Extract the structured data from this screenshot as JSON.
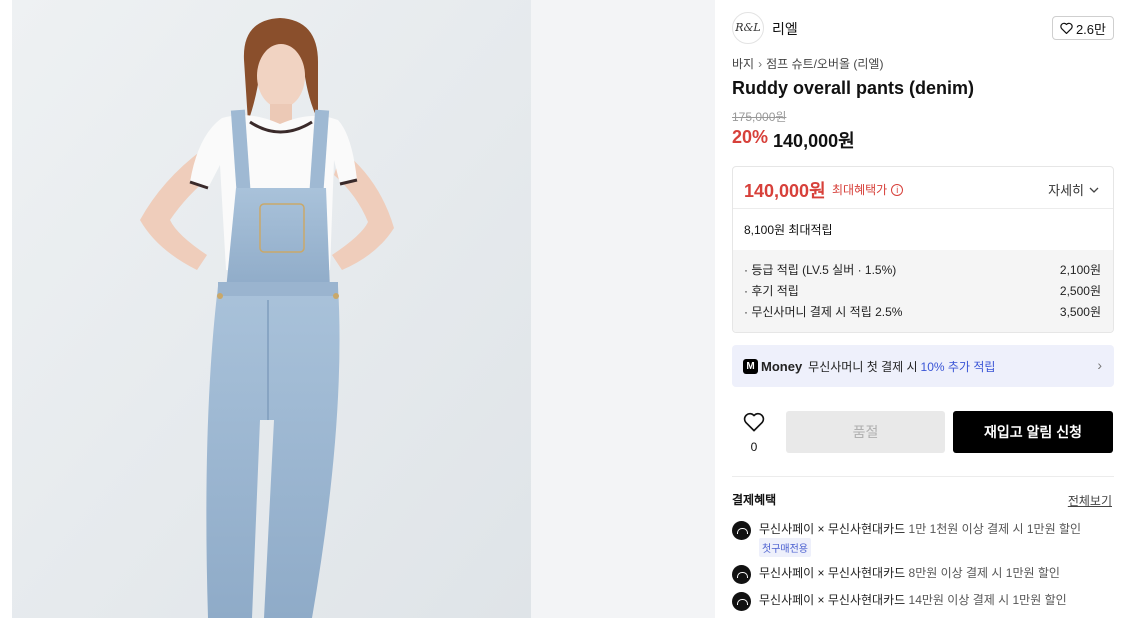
{
  "brand": {
    "logo_text": "R&L",
    "name": "리엘",
    "likes": "2.6만"
  },
  "breadcrumb": [
    "바지",
    "점프 슈트/오버올 (리엘)"
  ],
  "product": {
    "title": "Ruddy overall pants (denim)",
    "original_price": "175,000원",
    "discount": "20%",
    "price": "140,000원"
  },
  "benefit": {
    "max_price": "140,000원",
    "max_label": "최대혜택가",
    "detail_label": "자세히",
    "points_total": "8,100원 최대적립",
    "rows": [
      {
        "label": "· 등급 적립 (LV.5 실버 · 1.5%)",
        "value": "2,100원"
      },
      {
        "label": "· 후기 적립",
        "value": "2,500원"
      },
      {
        "label": "· 무신사머니 결제 시 적립 2.5%",
        "value": "3,500원"
      }
    ]
  },
  "money_banner": {
    "badge": "M",
    "word": "Money",
    "text_before": "무신사머니 첫 결제 시",
    "highlight": "10% 추가 적립"
  },
  "actions": {
    "wish_count": "0",
    "soldout_label": "품절",
    "restock_label": "재입고 알림 신청"
  },
  "payment": {
    "heading": "결제혜택",
    "see_all": "전체보기",
    "items": [
      {
        "name": "무신사페이 × 무신사현대카드",
        "condition": "1만 1천원 이상 결제 시 1만원 할인",
        "tag": "첫구매전용"
      },
      {
        "name": "무신사페이 × 무신사현대카드",
        "condition": "8만원 이상 결제 시 1만원 할인"
      },
      {
        "name": "무신사페이 × 무신사현대카드",
        "condition": "14만원 이상 결제 시 1만원 할인"
      }
    ]
  },
  "colors": {
    "accent_red": "#d7403a",
    "accent_blue": "#3a55d6",
    "photo_bg": "#e7ebee"
  }
}
